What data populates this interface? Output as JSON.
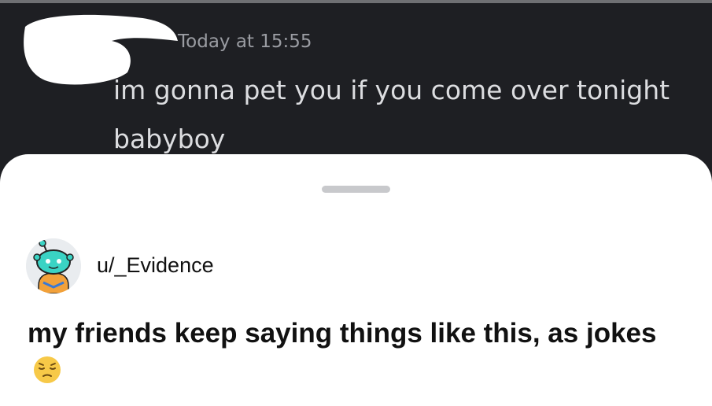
{
  "chat": {
    "timestamp": "Today at 15:55",
    "message": "im gonna pet you if you come over tonight babyboy"
  },
  "post": {
    "username": "u/_Evidence",
    "title": "my friends keep saying things like this, as jokes",
    "emoji_icon": "pensive-face-icon",
    "avatar_icon": "reddit-snoo-avatar-icon"
  },
  "colors": {
    "chat_background": "#1e1f23",
    "sheet_background": "#ffffff",
    "avatar_teal": "#3ad3c4"
  }
}
